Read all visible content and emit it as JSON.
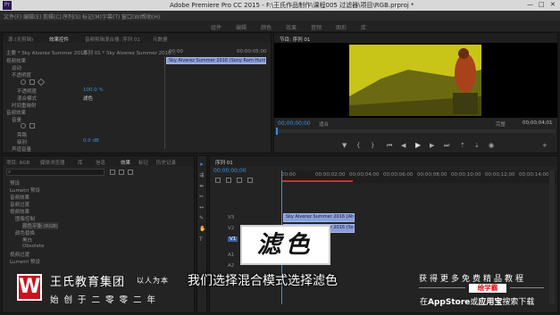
{
  "titlebar": {
    "title": "Adobe Premiere Pro CC 2015 - F:\\王氏作品制作\\课程005 过滤器\\项目\\RGB.prproj *",
    "logo": "Pr",
    "minimize": "—",
    "maximize": "□",
    "close": "✕"
  },
  "menu": {
    "items": [
      "文件(F)",
      "编辑(E)",
      "剪辑(C)",
      "序列(S)",
      "标记(M)",
      "字幕(T)",
      "窗口(W)",
      "帮助(H)"
    ]
  },
  "workspaces": {
    "items": [
      "组件",
      "编辑",
      "颜色",
      "效果",
      "音频",
      "图形",
      "库"
    ]
  },
  "effect_controls": {
    "tabs": [
      "源:(无剪辑)",
      "效果控件",
      "音频剪辑混合器: 序列 01",
      "元数据"
    ],
    "active_tab": 1,
    "source_label": "主要 * Sky Alverez Summer 2016...",
    "seq_label": "序列 01 * Sky Alverez Summer 2016...",
    "timecode_start": "00:00",
    "timecode_end": "00:00:05:00",
    "section_video": "视频效果",
    "fx_motion": "运动",
    "fx_opacity": "不透明度",
    "prop_opacity": "不透明度",
    "opacity_value": "100.0 %",
    "prop_blend": "混合模式",
    "blend_value": "滤色",
    "fx_timeremap": "时间重映射",
    "section_audio": "音频效果",
    "fx_volume": "音量",
    "prop_bypass": "旁路",
    "prop_level": "级别",
    "level_value": "0.0 dB",
    "fx_channel": "声道音量",
    "clip_bar_label": "Sky Alverez Summer 2016 (Sony Ram Hunt)",
    "bottom_time": "00:00:00:00"
  },
  "program": {
    "tab": "节目: 序列 01",
    "timecode_left": "00;00;00;00",
    "fit": "适合",
    "quality": "完整",
    "timecode_right": "00;00;04;01"
  },
  "project": {
    "tabs": [
      "项目: RGB",
      "媒体浏览器",
      "库",
      "信息",
      "效果",
      "标记",
      "历史记录"
    ],
    "active_tab": 4,
    "search_placeholder": "",
    "tree": [
      "预设",
      "Lumetri 预设",
      "音频效果",
      "音频过渡",
      "视频效果",
      "图像控制",
      "颜色平衡 (RGB)",
      "颜色替换",
      "黑白",
      "Obsolete",
      "视频过渡",
      "Lumetri 预设"
    ]
  },
  "timeline": {
    "tab": "序列 01",
    "timecode": "00;00;00;00",
    "ruler": [
      "00;00",
      "00;00;02;00",
      "00;00;04;00",
      "00;00;06;00",
      "00;00;08;00",
      "00;00;10;00",
      "00;00;12;00",
      "00;00;14;00"
    ],
    "tracks": [
      "V3",
      "V2",
      "V1",
      "A1",
      "A2",
      "A3"
    ],
    "clip_v2": "Sky Alverez Summer 2016 [Ahea...",
    "clip_v1": "Sky Alverez Summer 2016 (Sony Ram..."
  },
  "overlay": {
    "caption": "滤色",
    "subtitle": "我们选择混合模式选择滤色"
  },
  "brand": {
    "logo_letter": "W",
    "name": "王氏教育集团",
    "slogan": "以人为本",
    "tagline": "始创于二零零二年"
  },
  "promo": {
    "line1": "获得更多免费精品教程",
    "badge": "绘学霸",
    "line2_prefix": "在",
    "line2_store": "AppStore",
    "line2_mid": "或",
    "line2_app": "应用宝",
    "line2_suffix": "搜索下载"
  },
  "colors": {
    "accent_blue": "#3d8fe0",
    "clip_violet": "#8a9fd6",
    "playhead_red": "#d03030",
    "brand_red": "#c8141e",
    "video_yellow": "#c9c418"
  }
}
